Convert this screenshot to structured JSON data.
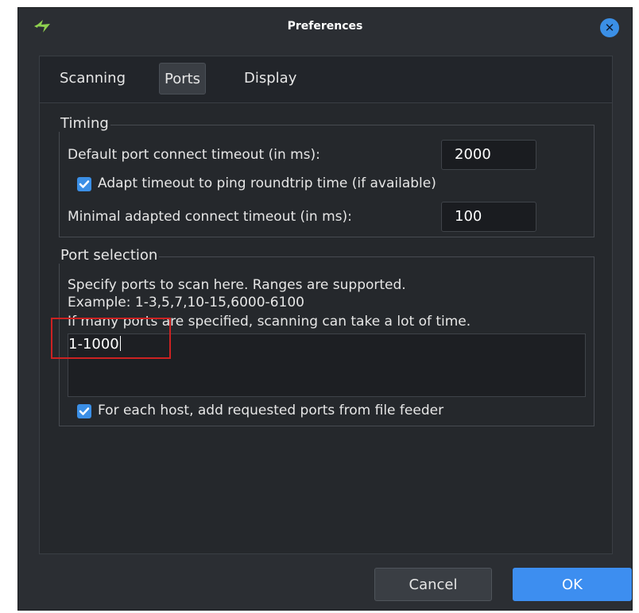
{
  "window": {
    "title": "Preferences",
    "app_icon": "lightning-icon",
    "close_icon": "close-icon",
    "close_symbol": "✕"
  },
  "tabs": [
    {
      "label": "Scanning",
      "active": false
    },
    {
      "label": "Ports",
      "active": true
    },
    {
      "label": "Display",
      "active": false
    }
  ],
  "timing": {
    "title": "Timing",
    "default_timeout_label": "Default port connect timeout (in ms):",
    "default_timeout_value": "2000",
    "adapt_label": "Adapt timeout to ping roundtrip time (if available)",
    "adapt_checked": true,
    "minimal_timeout_label": "Minimal adapted connect timeout (in ms):",
    "minimal_timeout_value": "100"
  },
  "port_selection": {
    "title": "Port selection",
    "description_line1": "Specify ports to scan here. Ranges are supported.",
    "description_line2": "Example: 1-3,5,7,10-15,6000-6100",
    "description_line3": "If many ports are specified, scanning can take a lot of time.",
    "ports_value": "1-1000",
    "file_feeder_label": "For each host, add requested ports from file feeder",
    "file_feeder_checked": true
  },
  "buttons": {
    "cancel": "Cancel",
    "ok": "OK"
  },
  "colors": {
    "accent": "#3d8ef0",
    "background": "#2b2e33",
    "highlight": "#cc2222"
  }
}
